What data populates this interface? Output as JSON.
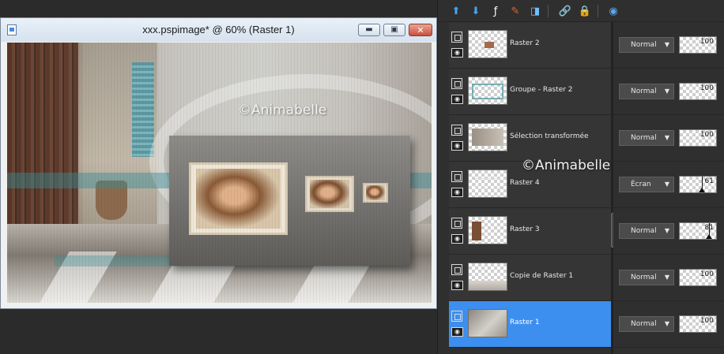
{
  "window": {
    "title": "xxx.pspimage* @  60% (Raster 1)",
    "min_glyph": "▬",
    "max_glyph": "▣",
    "close_glyph": "✕",
    "watermark": "©Animabelle"
  },
  "toolbar": {
    "tools": [
      {
        "icon": "new-layer-icon",
        "glyph": "⬆",
        "color": "#3fa9f5"
      },
      {
        "icon": "merge-down-icon",
        "glyph": "⬇",
        "color": "#3fa9f5"
      },
      {
        "icon": "fx-icon",
        "glyph": "ƒ",
        "color": "#ffffff"
      },
      {
        "icon": "brush-eraser-icon",
        "glyph": "✎",
        "color": "#e0652a"
      },
      {
        "icon": "layer-properties-icon",
        "glyph": "◨",
        "color": "#6fc1ff"
      },
      {
        "icon": "link-icon",
        "glyph": "🔗",
        "color": "#bbbbbb"
      },
      {
        "icon": "lock-icon",
        "glyph": "🔒",
        "color": "#e5b73b"
      },
      {
        "icon": "globe-icon",
        "glyph": "◉",
        "color": "#58a6f0"
      }
    ]
  },
  "layers": [
    {
      "name": "Raster 2",
      "blend": "Normal",
      "opacity": "100",
      "selected": false
    },
    {
      "name": "Groupe - Raster 2",
      "blend": "Normal",
      "opacity": "100",
      "selected": false
    },
    {
      "name": "Sélection transformée",
      "blend": "Normal",
      "opacity": "100",
      "selected": false
    },
    {
      "name": "Raster 4",
      "blend": "Écran",
      "opacity": "61",
      "selected": false
    },
    {
      "name": "Raster 3",
      "blend": "Normal",
      "opacity": "81",
      "selected": false
    },
    {
      "name": "Copie de Raster 1",
      "blend": "Normal",
      "opacity": "100",
      "selected": false
    },
    {
      "name": "Raster 1",
      "blend": "Normal",
      "opacity": "100",
      "selected": true
    }
  ],
  "panel": {
    "watermark": "©Animabelle",
    "eye_glyph": "◉",
    "caret_glyph": "▼",
    "splitter_glyph": "›"
  },
  "colors": {
    "selected_row": "#3d8fef",
    "panel_bg": "#2f2f2f"
  }
}
